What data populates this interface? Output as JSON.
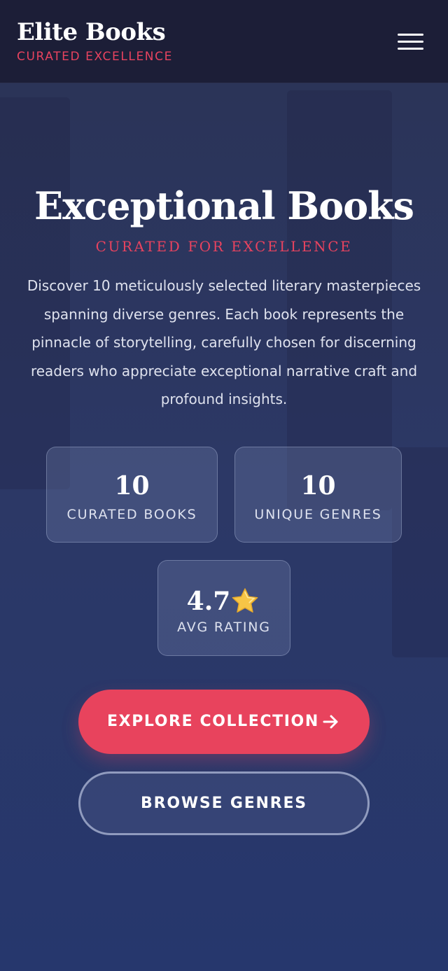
{
  "header": {
    "brand_title": "Elite Books",
    "brand_tagline": "CURATED EXCELLENCE",
    "menu_icon": "hamburger-menu-icon"
  },
  "hero": {
    "title": "Exceptional Books",
    "subtitle": "CURATED FOR EXCELLENCE",
    "description": "Discover 10 meticulously selected literary masterpieces spanning diverse genres. Each book represents the pinnacle of storytelling, carefully chosen for discerning readers who appreciate exceptional narrative craft and profound insights."
  },
  "stats": {
    "books": {
      "value": "10",
      "label": "CURATED BOOKS"
    },
    "genres": {
      "value": "10",
      "label": "UNIQUE GENRES"
    },
    "rating": {
      "value": "4.7",
      "label": "AVG RATING",
      "icon": "star-icon"
    }
  },
  "actions": {
    "primary_label": "EXPLORE COLLECTION",
    "primary_icon": "arrow-right-icon",
    "secondary_label": "BROWSE GENRES"
  },
  "colors": {
    "accent": "#e8435d",
    "header_bg": "#1c1e37",
    "hero_bg": "#2b3458",
    "star": "#f7c546"
  }
}
